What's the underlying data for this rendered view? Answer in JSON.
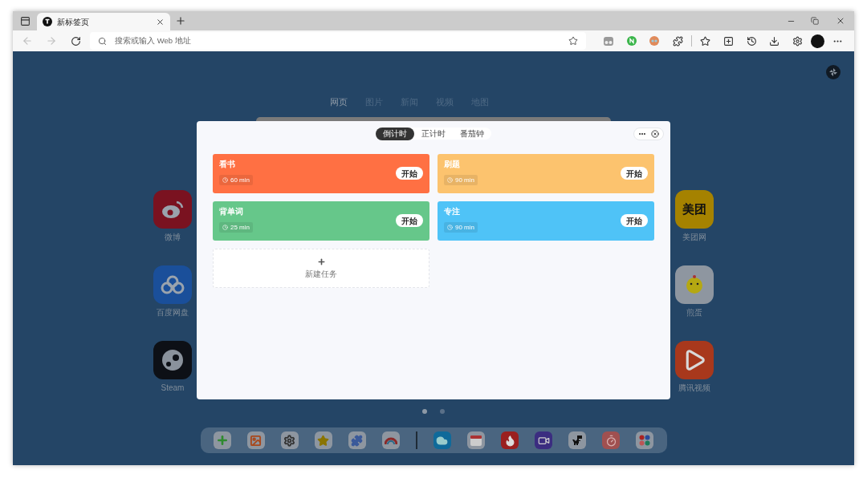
{
  "browser_tab": {
    "title": "新标签页"
  },
  "address_bar": {
    "placeholder": "搜索或输入 Web 地址"
  },
  "search_tabs": [
    {
      "label": "网页",
      "selected": true
    },
    {
      "label": "图片",
      "selected": false
    },
    {
      "label": "新闻",
      "selected": false
    },
    {
      "label": "视频",
      "selected": false
    },
    {
      "label": "地图",
      "selected": false
    }
  ],
  "apps_left": [
    {
      "label": "微博",
      "kind": "weibo"
    },
    {
      "label": "百度网盘",
      "kind": "cloud"
    },
    {
      "label": "Steam",
      "kind": "steam"
    }
  ],
  "apps_right": [
    {
      "label": "美团网",
      "kind": "meituan",
      "icon_text": "美团"
    },
    {
      "label": "煎蛋",
      "kind": "chick"
    },
    {
      "label": "腾讯视频",
      "kind": "video"
    }
  ],
  "pager": [
    {
      "selected": true
    },
    {
      "selected": false
    }
  ],
  "dock": [
    {
      "kind": "plus"
    },
    {
      "kind": "photo"
    },
    {
      "kind": "gear"
    },
    {
      "kind": "star"
    },
    {
      "kind": "puzzle"
    },
    {
      "kind": "chart"
    },
    {
      "kind": "divider"
    },
    {
      "kind": "weather"
    },
    {
      "kind": "calendar"
    },
    {
      "kind": "flame"
    },
    {
      "kind": "camera"
    },
    {
      "kind": "dino"
    },
    {
      "kind": "timer"
    },
    {
      "kind": "apps"
    }
  ],
  "timer_panel": {
    "mode_tabs": [
      {
        "label": "倒计时",
        "selected": true
      },
      {
        "label": "正计时",
        "selected": false
      },
      {
        "label": "番茄钟",
        "selected": false
      }
    ],
    "tasks": [
      {
        "title": "看书",
        "duration": "60 min",
        "button": "开始",
        "color": "#ff7043"
      },
      {
        "title": "刷题",
        "duration": "90 min",
        "button": "开始",
        "color": "#fcc36e"
      },
      {
        "title": "背单词",
        "duration": "25 min",
        "button": "开始",
        "color": "#66c78a"
      },
      {
        "title": "专注",
        "duration": "90 min",
        "button": "开始",
        "color": "#4fc3f7"
      }
    ],
    "new_task": {
      "label": "新建任务"
    }
  }
}
